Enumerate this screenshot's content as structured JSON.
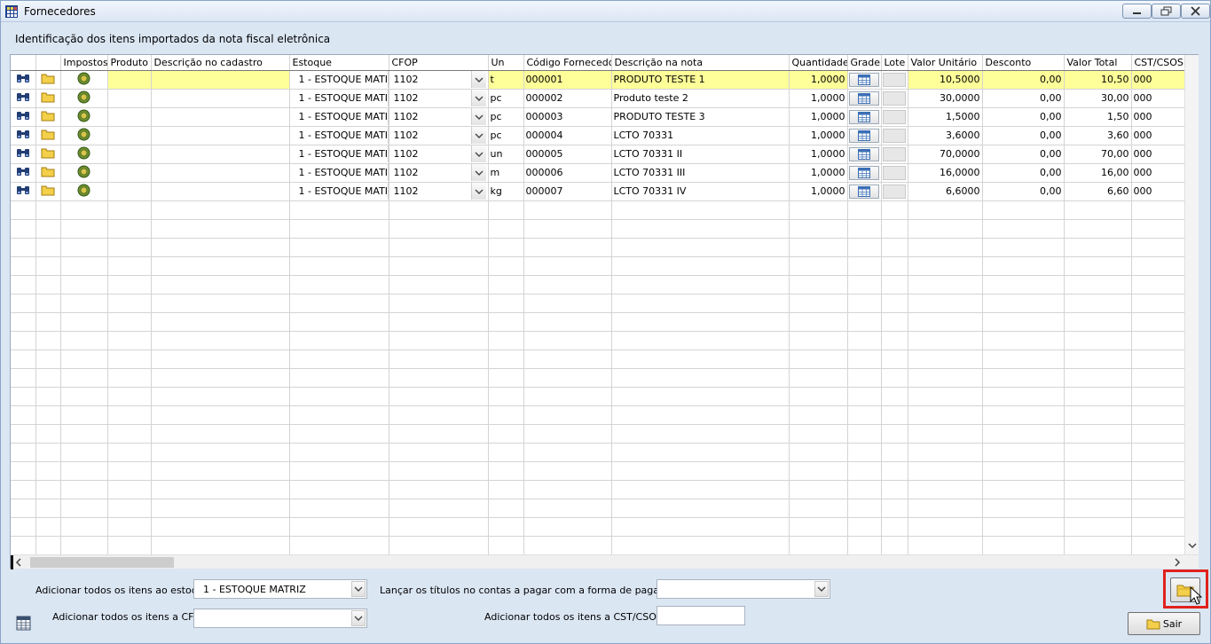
{
  "window": {
    "title": "Fornecedores"
  },
  "panel": {
    "header": "Identificação dos itens importados da nota fiscal eletrônica"
  },
  "grid": {
    "columns": [
      "",
      "",
      "Impostos",
      "Produto",
      "Descrição no cadastro",
      "Estoque",
      "CFOP",
      "Un",
      "Código Fornecedor",
      "Descrição na nota",
      "Quantidade",
      "Grade",
      "Lote",
      "Valor Unitário",
      "Desconto",
      "Valor Total",
      "CST/CSOSN"
    ],
    "rows": [
      {
        "estoque": "1 - ESTOQUE MATI",
        "cfop": "1102",
        "un": "t",
        "codigo": "000001",
        "descricao": "PRODUTO TESTE 1",
        "quantidade": "1,0000",
        "valor_unitario": "10,5000",
        "desconto": "0,00",
        "valor_total": "10,50",
        "cst": "000"
      },
      {
        "estoque": "1 - ESTOQUE MATI",
        "cfop": "1102",
        "un": "pc",
        "codigo": "000002",
        "descricao": "Produto teste 2",
        "quantidade": "1,0000",
        "valor_unitario": "30,0000",
        "desconto": "0,00",
        "valor_total": "30,00",
        "cst": "000"
      },
      {
        "estoque": "1 - ESTOQUE MATI",
        "cfop": "1102",
        "un": "pc",
        "codigo": "000003",
        "descricao": "PRODUTO TESTE 3",
        "quantidade": "1,0000",
        "valor_unitario": "1,5000",
        "desconto": "0,00",
        "valor_total": "1,50",
        "cst": "000"
      },
      {
        "estoque": "1 - ESTOQUE MATI",
        "cfop": "1102",
        "un": "pc",
        "codigo": "000004",
        "descricao": "LCTO 70331",
        "quantidade": "1,0000",
        "valor_unitario": "3,6000",
        "desconto": "0,00",
        "valor_total": "3,60",
        "cst": "000"
      },
      {
        "estoque": "1 - ESTOQUE MATI",
        "cfop": "1102",
        "un": "un",
        "codigo": "000005",
        "descricao": "LCTO 70331 II",
        "quantidade": "1,0000",
        "valor_unitario": "70,0000",
        "desconto": "0,00",
        "valor_total": "70,00",
        "cst": "000"
      },
      {
        "estoque": "1 - ESTOQUE MATI",
        "cfop": "1102",
        "un": "m",
        "codigo": "000006",
        "descricao": "LCTO 70331 III",
        "quantidade": "1,0000",
        "valor_unitario": "16,0000",
        "desconto": "0,00",
        "valor_total": "16,00",
        "cst": "000"
      },
      {
        "estoque": "1 - ESTOQUE MATI",
        "cfop": "1102",
        "un": "kg",
        "codigo": "000007",
        "descricao": "LCTO 70331 IV",
        "quantidade": "1,0000",
        "valor_unitario": "6,6000",
        "desconto": "0,00",
        "valor_total": "6,60",
        "cst": "000"
      }
    ],
    "selected_row": 0
  },
  "footer": {
    "estoque_label": "Adicionar todos os itens ao estoque",
    "estoque_value": "1 - ESTOQUE MATRIZ",
    "cfop_label": "Adicionar todos os itens a CFOP",
    "cfop_value": "",
    "pagamento_label": "Lançar os títulos no contas a pagar com a forma de pagamento",
    "pagamento_value": "",
    "cst_label": "Adicionar todos os itens a CST/CSOSN",
    "cst_value": "",
    "sair_label": "Sair"
  },
  "icons": {
    "app": "app-grid-icon",
    "search": "binoculars-icon",
    "folder": "folder-icon",
    "tax": "coin-icon",
    "grade": "table-icon",
    "export": "spreadsheet-icon",
    "cursor": "mouse-pointer-icon"
  },
  "colors": {
    "selected_row": "#ffff99",
    "highlight": "#e0221c",
    "frame": "#dbe6f3"
  }
}
